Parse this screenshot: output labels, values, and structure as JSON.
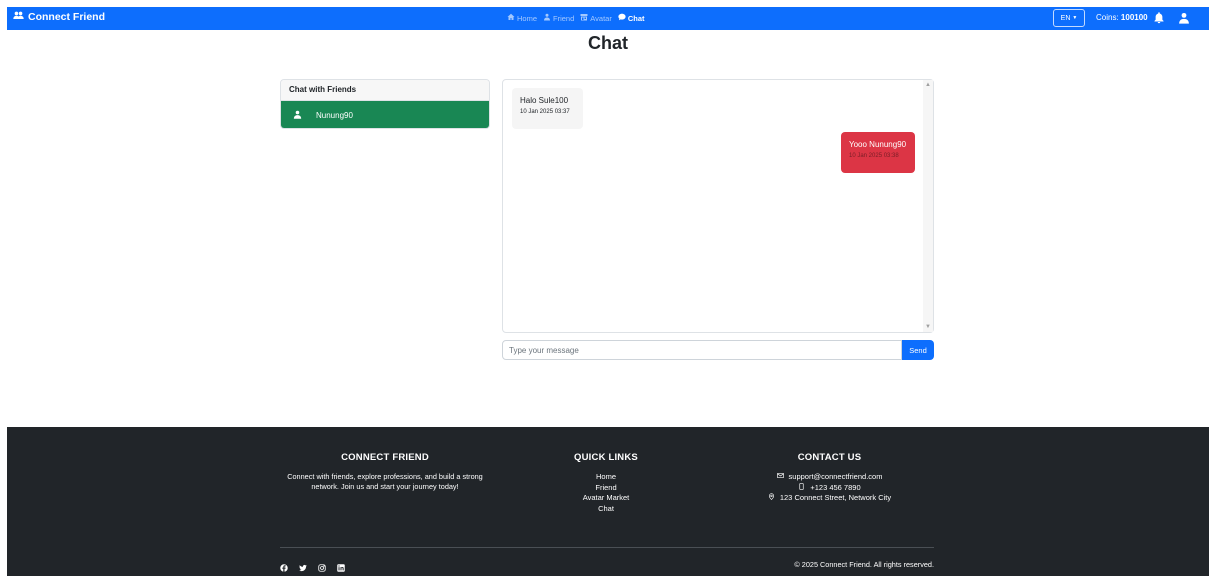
{
  "brand": {
    "name": "Connect Friend"
  },
  "nav": [
    {
      "label": "Home",
      "icon": "home-icon",
      "active": false
    },
    {
      "label": "Friend",
      "icon": "person-icon",
      "active": false
    },
    {
      "label": "Avatar",
      "icon": "store-icon",
      "active": false
    },
    {
      "label": "Chat",
      "icon": "chat-bubble-icon",
      "active": true
    }
  ],
  "language": {
    "selected": "EN"
  },
  "coins": {
    "label": "Coins:",
    "value": "100100"
  },
  "page": {
    "title": "Chat"
  },
  "friends": {
    "header": "Chat with Friends",
    "items": [
      {
        "name": "Nunung90",
        "selected": true
      }
    ]
  },
  "messages": [
    {
      "direction": "incoming",
      "text": "Halo Sule100",
      "time": "10 Jan 2025 03:37"
    },
    {
      "direction": "outgoing",
      "text": "Yooo Nunung90",
      "time": "10 Jan 2025 03:38"
    }
  ],
  "composer": {
    "placeholder": "Type your message",
    "value": "",
    "send_label": "Send"
  },
  "footer": {
    "about": {
      "title": "CONNECT FRIEND",
      "text": "Connect with friends, explore professions, and build a strong network. Join us and start your journey today!"
    },
    "quick_links": {
      "title": "QUICK LINKS",
      "links": [
        "Home",
        "Friend",
        "Avatar Market",
        "Chat"
      ]
    },
    "contact": {
      "title": "CONTACT US",
      "email": "support@connectfriend.com",
      "phone": "+123 456 7890",
      "address": "123 Connect Street, Network City"
    },
    "socials": [
      "facebook-icon",
      "twitter-icon",
      "instagram-icon",
      "linkedin-icon"
    ],
    "copyright": "© 2025 Connect Friend. All rights reserved."
  },
  "colors": {
    "primary": "#0d6efd",
    "friend_selected": "#198754",
    "outgoing_bubble": "#dc3545",
    "footer_bg": "#212529"
  }
}
